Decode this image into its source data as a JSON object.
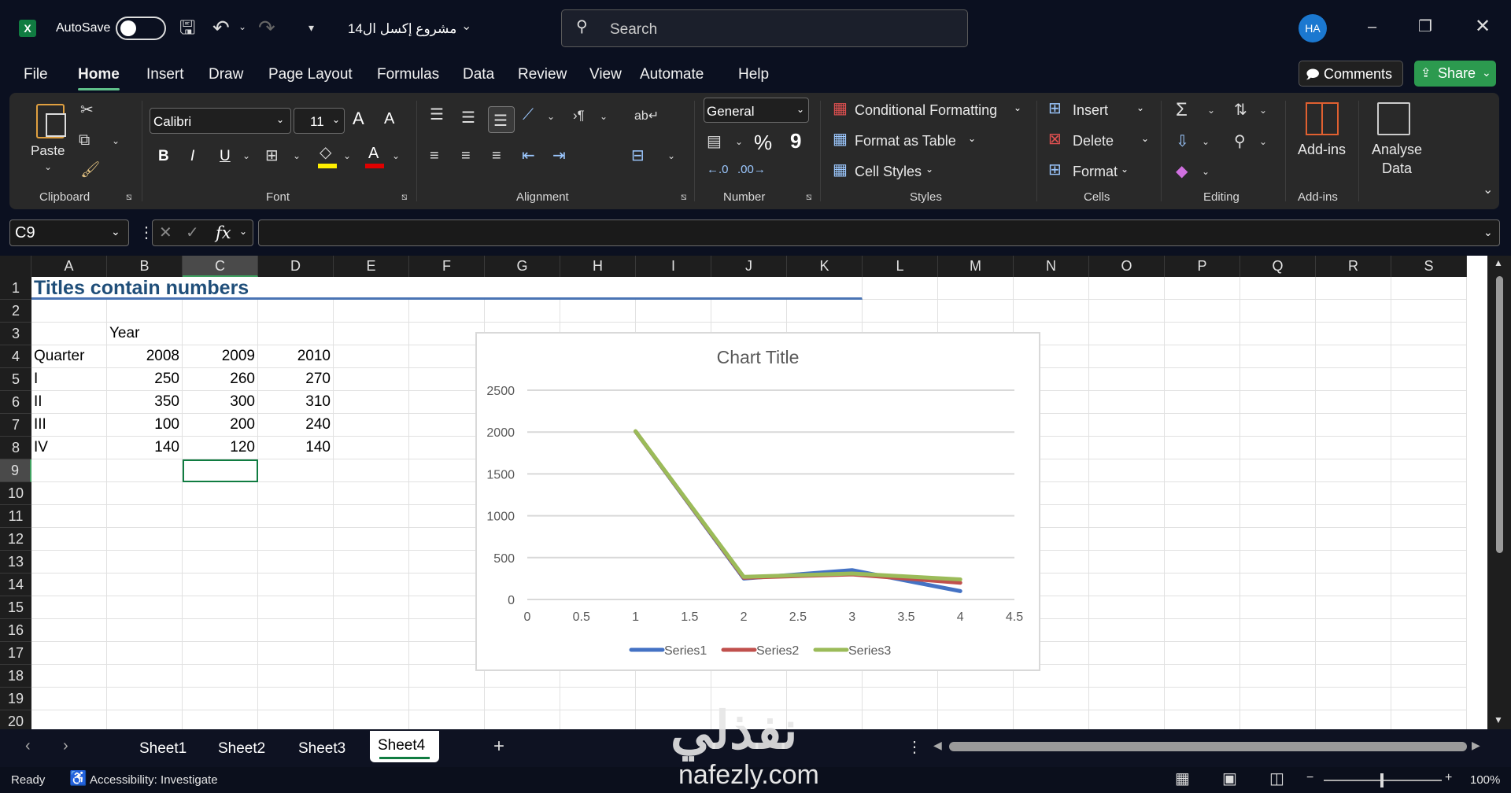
{
  "titlebar": {
    "autosave_label": "AutoSave",
    "autosave_on": false,
    "file_name": "مشروع إكسل ال14",
    "search_placeholder": "Search",
    "avatar_initials": "HA"
  },
  "menu": [
    "File",
    "Home",
    "Insert",
    "Draw",
    "Page Layout",
    "Formulas",
    "Data",
    "Review",
    "View",
    "Automate",
    "Help"
  ],
  "menu_active": "Home",
  "actions": {
    "comments": "Comments",
    "share": "Share"
  },
  "ribbon": {
    "clipboard": {
      "paste": "Paste",
      "label": "Clipboard"
    },
    "font": {
      "name": "Calibri",
      "size": "11",
      "bold": "B",
      "italic": "I",
      "underline": "U",
      "label": "Font",
      "grow": "A",
      "shrink": "A",
      "color_letter": "A"
    },
    "alignment": {
      "label": "Alignment"
    },
    "number": {
      "format": "General",
      "percent": "%",
      "comma": "9",
      "label": "Number"
    },
    "styles": {
      "conditional": "Conditional Formatting",
      "format_table": "Format as Table",
      "cell_styles": "Cell Styles",
      "label": "Styles"
    },
    "cells": {
      "insert": "Insert",
      "delete": "Delete",
      "format": "Format",
      "label": "Cells"
    },
    "editing": {
      "label": "Editing"
    },
    "addins": {
      "addins": "Add-ins",
      "analyse": "Analyse",
      "analyse2": "Data",
      "label": "Add-ins"
    }
  },
  "formula_bar": {
    "name_box": "C9",
    "fx": "fx",
    "value": ""
  },
  "columns": [
    "A",
    "B",
    "C",
    "D",
    "E",
    "F",
    "G",
    "H",
    "I",
    "J",
    "K",
    "L",
    "M",
    "N",
    "O",
    "P",
    "Q",
    "R",
    "S"
  ],
  "selected_cell": "C9",
  "cells": {
    "A1": "Titles contain numbers",
    "B3": "Year",
    "A4": "Quarter",
    "B4": "2008",
    "C4": "2009",
    "D4": "2010",
    "A5": "I",
    "B5": "250",
    "C5": "260",
    "D5": "270",
    "A6": "II",
    "B6": "350",
    "C6": "300",
    "D6": "310",
    "A7": "III",
    "B7": "100",
    "C7": "200",
    "D7": "240",
    "A8": "IV",
    "B8": "140",
    "C8": "120",
    "D8": "140"
  },
  "chart_data": {
    "type": "line",
    "title": "Chart Title",
    "x": [
      1,
      2,
      3,
      4
    ],
    "series": [
      {
        "name": "Series1",
        "color": "#4472c4",
        "values": [
          2008,
          250,
          350,
          100
        ]
      },
      {
        "name": "Series2",
        "color": "#c0504d",
        "values": [
          2009,
          260,
          300,
          200
        ]
      },
      {
        "name": "Series3",
        "color": "#9bbb59",
        "values": [
          2010,
          270,
          310,
          240
        ]
      }
    ],
    "xlim": [
      0,
      4.5
    ],
    "ylim": [
      0,
      2500
    ],
    "xticks": [
      "0",
      "0.5",
      "1",
      "1.5",
      "2",
      "2.5",
      "3",
      "3.5",
      "4",
      "4.5"
    ],
    "yticks": [
      "0",
      "500",
      "1000",
      "1500",
      "2000",
      "2500"
    ],
    "grid": true,
    "legend": "bottom"
  },
  "sheets": [
    "Sheet1",
    "Sheet2",
    "Sheet3",
    "Sheet4"
  ],
  "active_sheet": "Sheet4",
  "status": {
    "ready": "Ready",
    "accessibility": "Accessibility: Investigate",
    "zoom": "100%"
  },
  "watermark": {
    "arabic": "نفذلي",
    "latin": "nafezly.com"
  }
}
